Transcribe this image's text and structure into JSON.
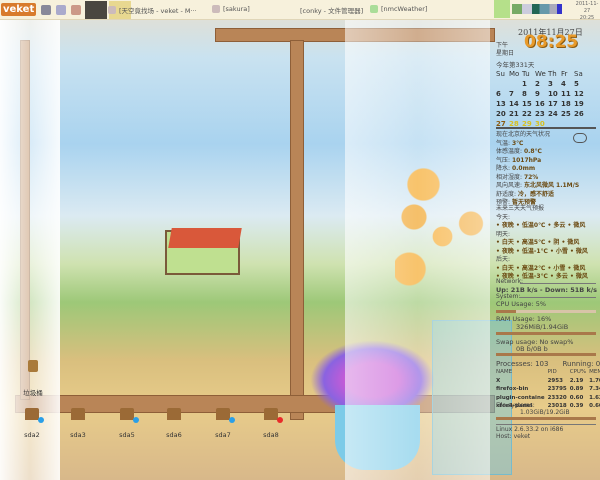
{
  "taskbar": {
    "logo": "veket",
    "tasks": [
      "[天空竟找场 - veket - M···",
      "[sakura]",
      "[conky - 文件管理器]",
      "[nmcWeather]"
    ],
    "tray_date": "2011-11-27",
    "tray_time": "20:25"
  },
  "desktop": {
    "trash": "垃圾桶",
    "drives": [
      {
        "label": "sda2",
        "status": "#2a9fe8"
      },
      {
        "label": "sda3",
        "status": ""
      },
      {
        "label": "sda5",
        "status": "#2a9fe8"
      },
      {
        "label": "sda6",
        "status": ""
      },
      {
        "label": "sda7",
        "status": "#2a9fe8"
      },
      {
        "label": "sda8",
        "status": "#e82a2a"
      }
    ]
  },
  "clock": {
    "date": "2011年11月27日",
    "ampm": "下午",
    "weekday": "星期日",
    "time": "08:25",
    "day_of_year": "今年第331天"
  },
  "calendar": {
    "headers": [
      "Su",
      "Mo",
      "Tu",
      "We",
      "Th",
      "Fr",
      "Sa"
    ],
    "leading_blanks": 2,
    "days": [
      "1",
      "2",
      "3",
      "4",
      "5",
      "6",
      "7",
      "8",
      "9",
      "10",
      "11",
      "12",
      "13",
      "14",
      "15",
      "16",
      "17",
      "18",
      "19",
      "20",
      "21",
      "22",
      "23",
      "24",
      "25",
      "26",
      "27",
      "28",
      "29",
      "30"
    ]
  },
  "weather": {
    "title": "现在北京的天气状况",
    "lines": [
      [
        "气温: ",
        "3℃"
      ],
      [
        "体感温度: ",
        "0.8℃"
      ],
      [
        "气压: ",
        "1017hPa"
      ],
      [
        "降水: ",
        "0.0mm"
      ],
      [
        "相对湿度: ",
        "72%"
      ],
      [
        "风向风速: ",
        "东北风微风 1.1M/S"
      ],
      [
        "舒适度: ",
        "冷，感不舒适"
      ],
      [
        "预警: ",
        "暂无预警"
      ]
    ]
  },
  "forecast": {
    "title": "未来三天天气预报",
    "lines": [
      "今天:",
      "• 夜晚 • 低温0℃ • 多云 • 微风",
      "明天:",
      "• 白天 • 高温5℃ • 阴 • 微风",
      "• 夜晚 • 低温-1℃ • 小雪 • 微风",
      "后天:",
      "• 白天 • 高温2℃ • 小雪 • 微风",
      "• 夜晚 • 低温-3℃ • 多云 • 微风"
    ]
  },
  "system": {
    "network_label": "Network:",
    "net": "Up: 21B  k/s - Down: 51B  k/s",
    "system_label": "System:",
    "cpu": "CPU Usage: 5%",
    "cpu_pct": 5,
    "ram": "RAM Usage: 16%",
    "ram_pct": 16,
    "ram_detail": "326MiB/1.94GiB",
    "swap": "Swap usage: No swap%",
    "swap_detail": "0B  b/0B  b",
    "swap_pct": 0,
    "processes": "Processes: 103",
    "running": "Running: 0",
    "proc_headers": [
      "NAME",
      "PID",
      "CPU%",
      "MEM%"
    ],
    "procs": [
      [
        "X",
        "2953",
        "2.19",
        "1.70"
      ],
      [
        "firefox-bin",
        "23795",
        "0.89",
        "7.34"
      ],
      [
        "plugin-containe",
        "23320",
        "0.60",
        "1.62"
      ],
      [
        "xfce4-panel",
        "23018",
        "0.39",
        "0.60"
      ]
    ],
    "fs_label": "File systems:",
    "fs": "1.03GiB/19.2GiB",
    "fs_pct": 5,
    "linux": "Linux 2.6.33.2 on i686",
    "host": "Host: veket"
  }
}
